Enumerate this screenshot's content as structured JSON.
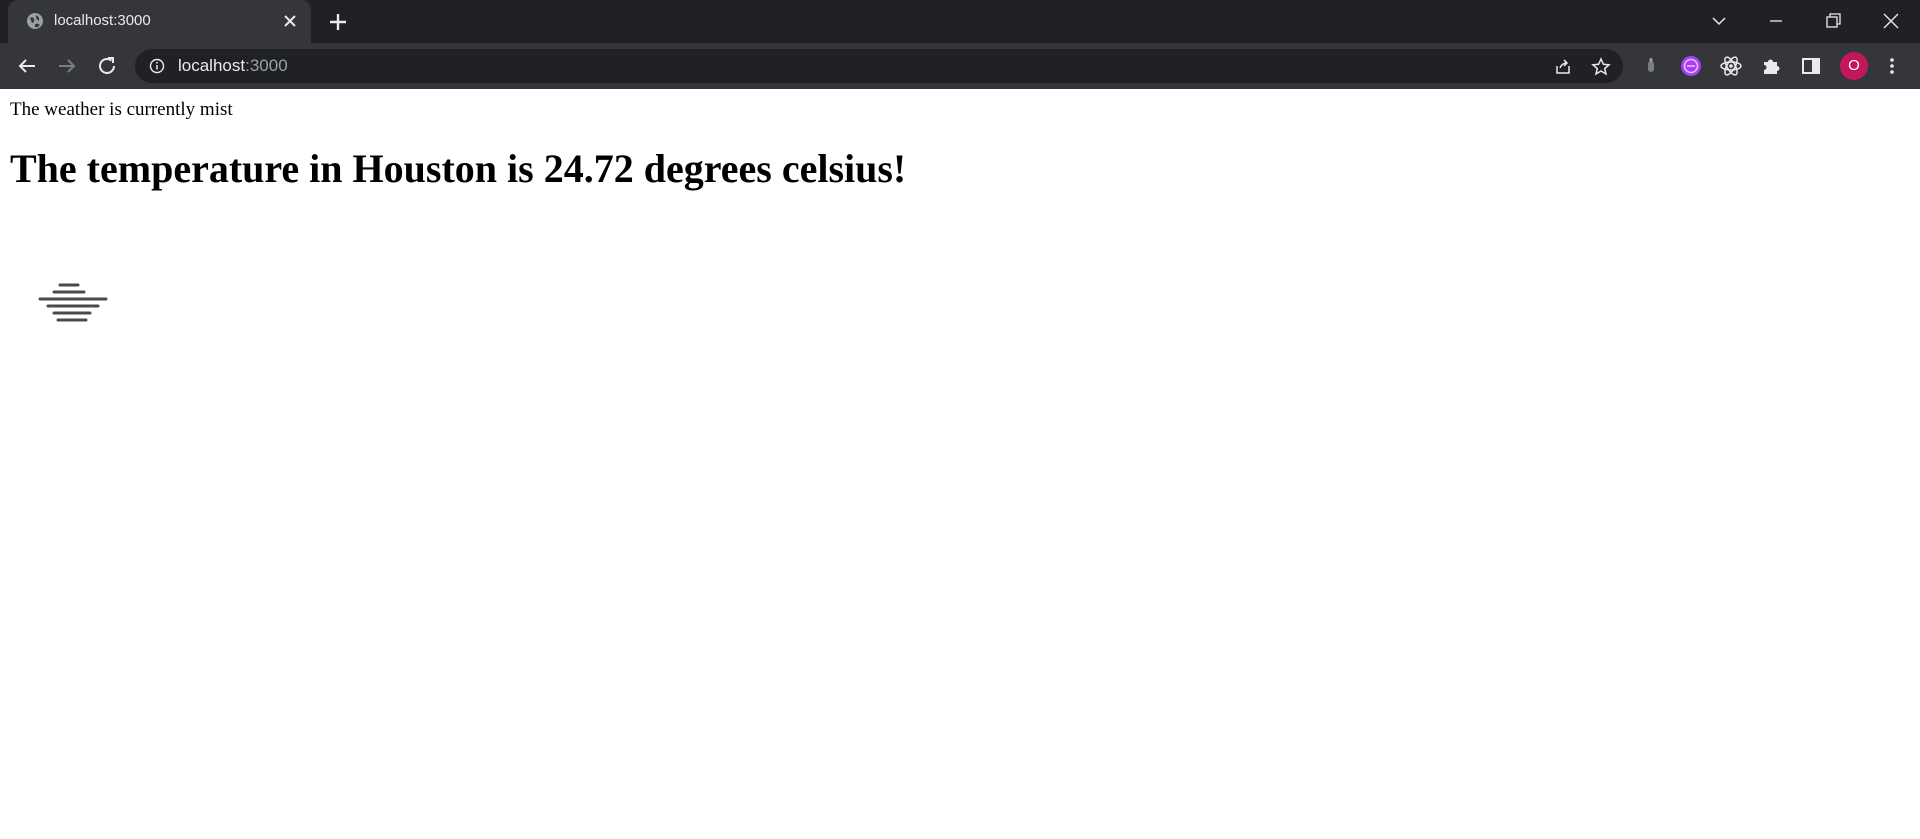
{
  "browser": {
    "tab": {
      "title": "localhost:3000"
    },
    "address": {
      "host": "localhost",
      "port": ":3000"
    },
    "avatar_letter": "O",
    "icons": {
      "tab_favicon": "globe-icon",
      "tab_close": "close-icon",
      "new_tab": "plus-icon",
      "tab_search": "chevron-down-icon",
      "minimize": "minimize-icon",
      "restore": "restore-icon",
      "close_window": "close-icon",
      "back": "back-arrow-icon",
      "forward": "forward-arrow-icon",
      "reload": "reload-icon",
      "site_info": "info-icon",
      "share": "share-icon",
      "bookmark": "star-icon",
      "extensions": "puzzle-icon",
      "side_panel": "side-panel-icon",
      "menu": "kebab-menu-icon"
    },
    "colors": {
      "frame": "#202124",
      "toolbar": "#35363a",
      "avatar": "#c2185b"
    }
  },
  "page": {
    "weather_description": "The weather is currently mist",
    "temperature_heading": "The temperature in Houston is 24.72 degrees celsius!",
    "weather_icon": "mist-icon"
  }
}
